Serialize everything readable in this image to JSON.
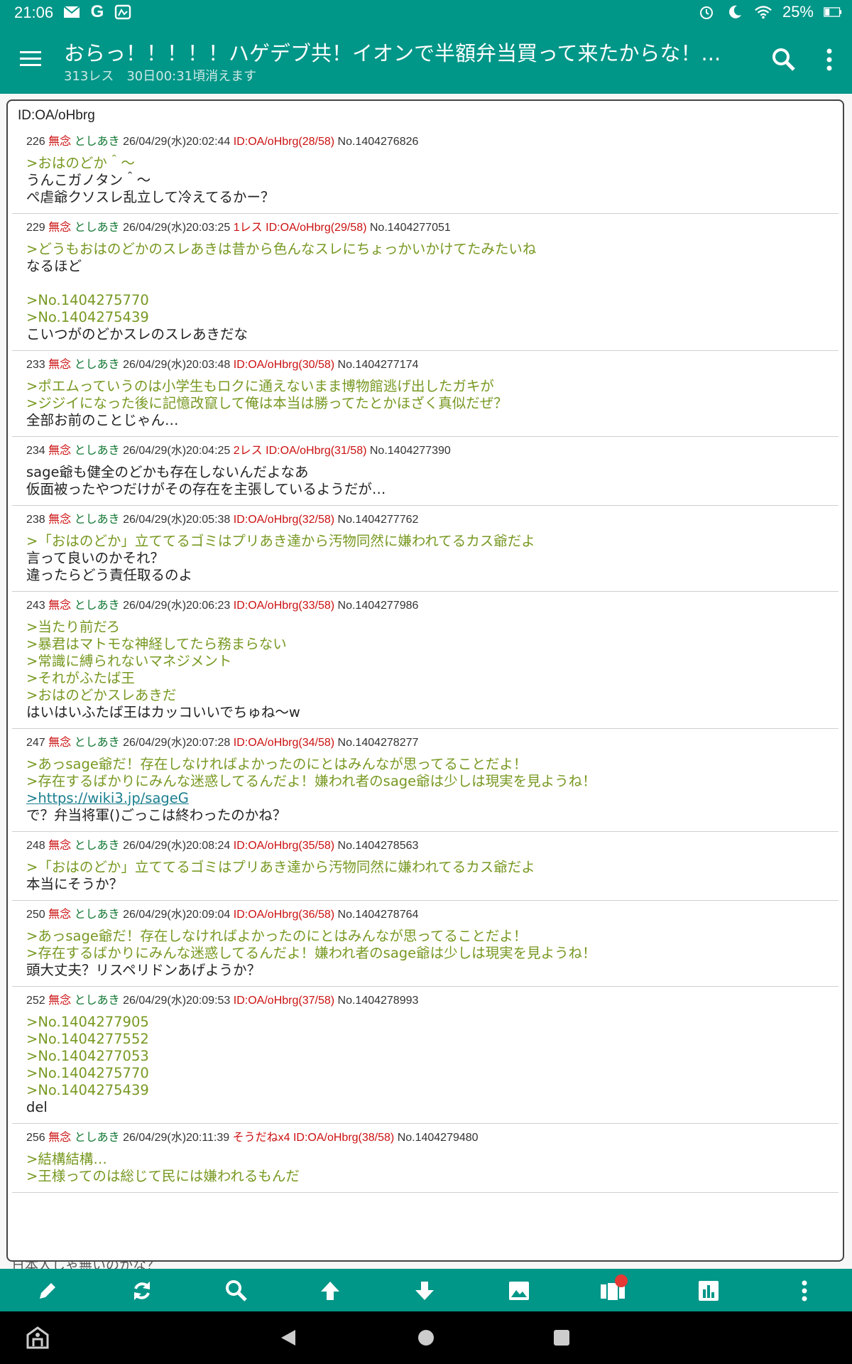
{
  "status": {
    "time": "21:06",
    "battery": "25%"
  },
  "appbar": {
    "title": "おらっ！！！！！ハゲデブ共！イオンで半額弁当買って来たからな！...",
    "res_count": "313レス",
    "expire": "30日00:31頃消えます"
  },
  "popup": {
    "title": "ID:OA/oHbrg",
    "posts": [
      {
        "num": "226",
        "mu": "無念",
        "name": "としあき",
        "date": "26/04/29(水)20:02:44",
        "extra": "",
        "id": "ID:OA/oHbrg(28/58)",
        "no": "No.1404276826",
        "lines": [
          {
            "t": ">おはのどか＾～",
            "q": true
          },
          {
            "t": "うんこガノタン＾～",
            "q": false
          },
          {
            "t": "ぺ虐爺クソスレ乱立して冷えてるかー？",
            "q": false
          }
        ]
      },
      {
        "num": "229",
        "mu": "無念",
        "name": "としあき",
        "date": "26/04/29(水)20:03:25",
        "extra": "1レス",
        "id": "ID:OA/oHbrg(29/58)",
        "no": "No.1404277051",
        "lines": [
          {
            "t": ">どうもおはのどかのスレあきは昔から色んなスレにちょっかいかけてたみたいね",
            "q": true
          },
          {
            "t": "なるほど",
            "q": false
          },
          {
            "t": "",
            "q": false
          },
          {
            "t": ">No.1404275770",
            "q": true
          },
          {
            "t": ">No.1404275439",
            "q": true
          },
          {
            "t": "こいつがのどかスレのスレあきだな",
            "q": false
          }
        ]
      },
      {
        "num": "233",
        "mu": "無念",
        "name": "としあき",
        "date": "26/04/29(水)20:03:48",
        "extra": "",
        "id": "ID:OA/oHbrg(30/58)",
        "no": "No.1404277174",
        "lines": [
          {
            "t": ">ポエムっていうのは小学生もロクに通えないまま博物館逃げ出したガキが",
            "q": true
          },
          {
            "t": ">ジジイになった後に記憶改竄して俺は本当は勝ってたとかほざく真似だぜ？",
            "q": true
          },
          {
            "t": "全部お前のことじゃん…",
            "q": false
          }
        ]
      },
      {
        "num": "234",
        "mu": "無念",
        "name": "としあき",
        "date": "26/04/29(水)20:04:25",
        "extra": "2レス",
        "id": "ID:OA/oHbrg(31/58)",
        "no": "No.1404277390",
        "lines": [
          {
            "t": "sage爺も健全のどかも存在しないんだよなあ",
            "q": false
          },
          {
            "t": "仮面被ったやつだけがその存在を主張しているようだが…",
            "q": false
          }
        ]
      },
      {
        "num": "238",
        "mu": "無念",
        "name": "としあき",
        "date": "26/04/29(水)20:05:38",
        "extra": "",
        "id": "ID:OA/oHbrg(32/58)",
        "no": "No.1404277762",
        "lines": [
          {
            "t": ">「おはのどか」立ててるゴミはプリあき達から汚物同然に嫌われてるカス爺だよ",
            "q": true
          },
          {
            "t": "言って良いのかそれ？",
            "q": false
          },
          {
            "t": "違ったらどう責任取るのよ",
            "q": false
          }
        ]
      },
      {
        "num": "243",
        "mu": "無念",
        "name": "としあき",
        "date": "26/04/29(水)20:06:23",
        "extra": "",
        "id": "ID:OA/oHbrg(33/58)",
        "no": "No.1404277986",
        "lines": [
          {
            "t": ">当たり前だろ",
            "q": true
          },
          {
            "t": ">暴君はマトモな神経してたら務まらない",
            "q": true
          },
          {
            "t": ">常識に縛られないマネジメント",
            "q": true
          },
          {
            "t": ">それがふたば王",
            "q": true
          },
          {
            "t": ">おはのどかスレあきだ",
            "q": true
          },
          {
            "t": "はいはいふたば王はカッコいいでちゅね～w",
            "q": false
          }
        ]
      },
      {
        "num": "247",
        "mu": "無念",
        "name": "としあき",
        "date": "26/04/29(水)20:07:28",
        "extra": "",
        "id": "ID:OA/oHbrg(34/58)",
        "no": "No.1404278277",
        "lines": [
          {
            "t": ">あっsage爺だ！存在しなければよかったのにとはみんなが思ってることだよ！",
            "q": true
          },
          {
            "t": ">存在するばかりにみんな迷惑してるんだよ！嫌われ者のsage爺は少しは現実を見ようね！",
            "q": true
          },
          {
            "t": ">https://wiki3.jp/sageG",
            "q": true,
            "link": true
          },
          {
            "t": "で？弁当将軍()ごっこは終わったのかね？",
            "q": false
          }
        ]
      },
      {
        "num": "248",
        "mu": "無念",
        "name": "としあき",
        "date": "26/04/29(水)20:08:24",
        "extra": "",
        "id": "ID:OA/oHbrg(35/58)",
        "no": "No.1404278563",
        "lines": [
          {
            "t": ">「おはのどか」立ててるゴミはプリあき達から汚物同然に嫌われてるカス爺だよ",
            "q": true
          },
          {
            "t": "本当にそうか？",
            "q": false
          }
        ]
      },
      {
        "num": "250",
        "mu": "無念",
        "name": "としあき",
        "date": "26/04/29(水)20:09:04",
        "extra": "",
        "id": "ID:OA/oHbrg(36/58)",
        "no": "No.1404278764",
        "lines": [
          {
            "t": ">あっsage爺だ！存在しなければよかったのにとはみんなが思ってることだよ！",
            "q": true
          },
          {
            "t": ">存在するばかりにみんな迷惑してるんだよ！嫌われ者のsage爺は少しは現実を見ようね！",
            "q": true
          },
          {
            "t": "頭大丈夫？リスペリドンあげようか？",
            "q": false
          }
        ]
      },
      {
        "num": "252",
        "mu": "無念",
        "name": "としあき",
        "date": "26/04/29(水)20:09:53",
        "extra": "",
        "id": "ID:OA/oHbrg(37/58)",
        "no": "No.1404278993",
        "lines": [
          {
            "t": ">No.1404277905",
            "q": true
          },
          {
            "t": ">No.1404277552",
            "q": true
          },
          {
            "t": ">No.1404277053",
            "q": true
          },
          {
            "t": ">No.1404275770",
            "q": true
          },
          {
            "t": ">No.1404275439",
            "q": true
          },
          {
            "t": "del",
            "q": false
          }
        ]
      },
      {
        "num": "256",
        "mu": "無念",
        "name": "としあき",
        "date": "26/04/29(水)20:11:39",
        "extra": "そうだねx4",
        "id": "ID:OA/oHbrg(38/58)",
        "no": "No.1404279480",
        "lines": [
          {
            "t": ">結構結構…",
            "q": true
          },
          {
            "t": ">王様ってのは総じて民には嫌われるもんだ",
            "q": true
          }
        ]
      }
    ]
  },
  "behind_text": "日本人しゃ無いのかな？",
  "toolbar": [
    "pencil-icon",
    "refresh-icon",
    "search-icon",
    "arrow-up-icon",
    "arrow-down-icon",
    "image-icon",
    "cards-icon",
    "chart-icon",
    "more-vert-icon"
  ],
  "colors": {
    "primary": "#009688",
    "quote": "#789922",
    "red": "#cc1111",
    "name": "#117733"
  }
}
